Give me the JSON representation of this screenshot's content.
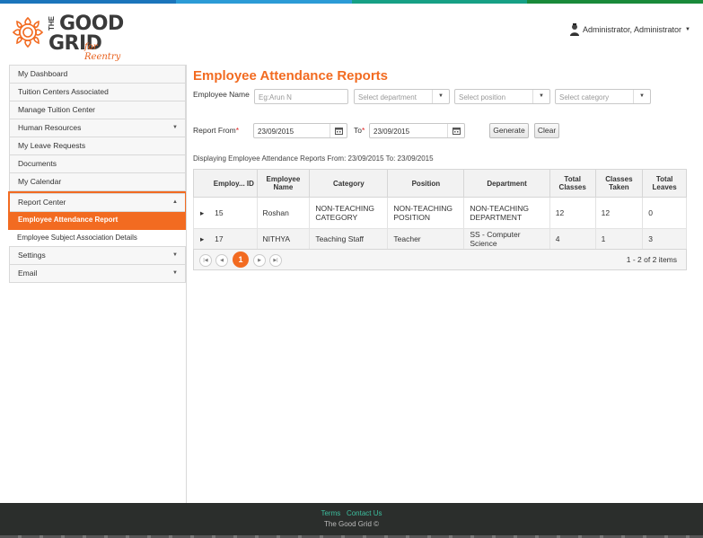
{
  "header": {
    "logo_the": "THE",
    "logo_good": "GOOD",
    "logo_grid": "GRID",
    "logo_tagline": "for Reentry",
    "user_label": "Administrator, Administrator",
    "colors": {
      "accent": "#f26b21",
      "topbar": [
        "#1b75bb",
        "#2b9bd6",
        "#16a085",
        "#1a8a3a"
      ]
    }
  },
  "sidebar": {
    "items": [
      {
        "label": "My Dashboard"
      },
      {
        "label": "Tuition Centers Associated"
      },
      {
        "label": "Manage Tuition Center"
      },
      {
        "label": "Human Resources",
        "arrow": "▼"
      },
      {
        "label": "My Leave Requests"
      },
      {
        "label": "Documents"
      },
      {
        "label": "My Calendar"
      }
    ],
    "report_center": {
      "label": "Report Center",
      "arrow": "▲",
      "sub_active": "Employee Attendance Report",
      "sub_other": "Employee Subject Association Details"
    },
    "items_after": [
      {
        "label": "Settings",
        "arrow": "▼"
      },
      {
        "label": "Email",
        "arrow": "▼"
      }
    ]
  },
  "main": {
    "title": "Employee Attendance Reports",
    "employee_name_label": "Employee Name",
    "employee_name_placeholder": "Eg:Arun N",
    "department_placeholder": "Select department",
    "position_placeholder": "Select position",
    "category_placeholder": "Select category",
    "report_from_label": "Report From",
    "from_date": "23/09/2015",
    "to_label": "To",
    "to_date": "23/09/2015",
    "required_mark": "*",
    "generate_label": "Generate",
    "clear_label": "Clear",
    "info": "Displaying Employee Attendance Reports From: 23/09/2015 To: 23/09/2015"
  },
  "table": {
    "headers": [
      "Employ... ID",
      "Employee Name",
      "Category",
      "Position",
      "Department",
      "Total Classes",
      "Classes Taken",
      "Total Leaves"
    ],
    "rows": [
      [
        "15",
        "Roshan",
        "NON-TEACHING CATEGORY",
        "NON-TEACHING POSITION",
        "NON-TEACHING DEPARTMENT",
        "12",
        "12",
        "0"
      ],
      [
        "17",
        "NITHYA",
        "Teaching Staff",
        "Teacher",
        "SS - Computer Science",
        "4",
        "1",
        "3"
      ]
    ],
    "expand_glyph": "▸",
    "current_page": "1",
    "count": "1 - 2 of 2 items"
  },
  "footer": {
    "terms": "Terms",
    "contact": "Contact Us",
    "copyright": "The Good Grid ©"
  }
}
